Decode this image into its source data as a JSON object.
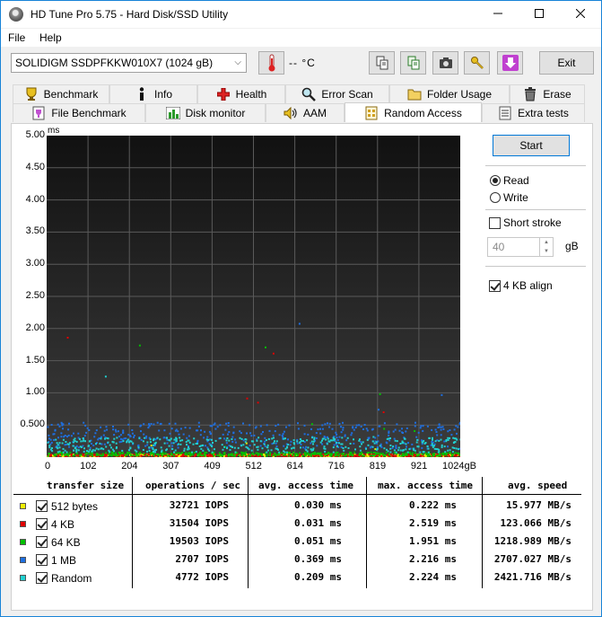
{
  "window": {
    "title": "HD Tune Pro 5.75 - Hard Disk/SSD Utility"
  },
  "menu": {
    "file": "File",
    "help": "Help"
  },
  "toolbar": {
    "drive": "SOLIDIGM SSDPFKKW010X7 (1024 gB)",
    "temperature": "-- °C",
    "exit": "Exit"
  },
  "tabs_row1": [
    "Benchmark",
    "Info",
    "Health",
    "Error Scan",
    "Folder Usage",
    "Erase"
  ],
  "tabs_row2": [
    "File Benchmark",
    "Disk monitor",
    "AAM",
    "Random Access",
    "Extra tests"
  ],
  "active_tab": "Random Access",
  "options": {
    "start": "Start",
    "read": "Read",
    "write": "Write",
    "mode": "read",
    "short_stroke_label": "Short stroke",
    "short_stroke_checked": false,
    "short_stroke_value": "40",
    "short_stroke_unit": "gB",
    "align_label": "4 KB align",
    "align_checked": true
  },
  "chart_data": {
    "type": "scatter",
    "ylabel": "ms",
    "ylim": [
      0,
      5
    ],
    "yticks": [
      "0.500",
      "1.00",
      "1.50",
      "2.00",
      "2.50",
      "3.00",
      "3.50",
      "4.00",
      "4.50",
      "5.00"
    ],
    "xlim": [
      0,
      1024
    ],
    "xticks": [
      "0",
      "102",
      "204",
      "307",
      "409",
      "512",
      "614",
      "716",
      "819",
      "921",
      "1024gB"
    ],
    "grid": true,
    "series": [
      {
        "name": "512 bytes",
        "color": "#f0f000",
        "typical_ms": 0.03,
        "max_ms": 0.222
      },
      {
        "name": "4 KB",
        "color": "#e00000",
        "typical_ms": 0.031,
        "max_ms": 2.519
      },
      {
        "name": "64 KB",
        "color": "#00c000",
        "typical_ms": 0.051,
        "max_ms": 1.951
      },
      {
        "name": "1 MB",
        "color": "#1e6fe0",
        "typical_ms": 0.369,
        "max_ms": 2.216
      },
      {
        "name": "Random",
        "color": "#20d0d0",
        "typical_ms": 0.209,
        "max_ms": 2.224
      }
    ]
  },
  "results": {
    "headers": {
      "size": "transfer size",
      "ops": "operations / sec",
      "avg": "avg. access time",
      "max": "max. access time",
      "speed": "avg. speed"
    },
    "rows": [
      {
        "name": "512 bytes",
        "color": "#f0f000",
        "checked": true,
        "ops": "32721 IOPS",
        "avg": "0.030 ms",
        "max": "0.222 ms",
        "speed": "15.977 MB/s"
      },
      {
        "name": "4 KB",
        "color": "#e00000",
        "checked": true,
        "ops": "31504 IOPS",
        "avg": "0.031 ms",
        "max": "2.519 ms",
        "speed": "123.066 MB/s"
      },
      {
        "name": "64 KB",
        "color": "#00c000",
        "checked": true,
        "ops": "19503 IOPS",
        "avg": "0.051 ms",
        "max": "1.951 ms",
        "speed": "1218.989 MB/s"
      },
      {
        "name": "1 MB",
        "color": "#1e6fe0",
        "checked": true,
        "ops": "2707 IOPS",
        "avg": "0.369 ms",
        "max": "2.216 ms",
        "speed": "2707.027 MB/s"
      },
      {
        "name": "Random",
        "color": "#20d0d0",
        "checked": true,
        "ops": "4772 IOPS",
        "avg": "0.209 ms",
        "max": "2.224 ms",
        "speed": "2421.716 MB/s"
      }
    ]
  }
}
